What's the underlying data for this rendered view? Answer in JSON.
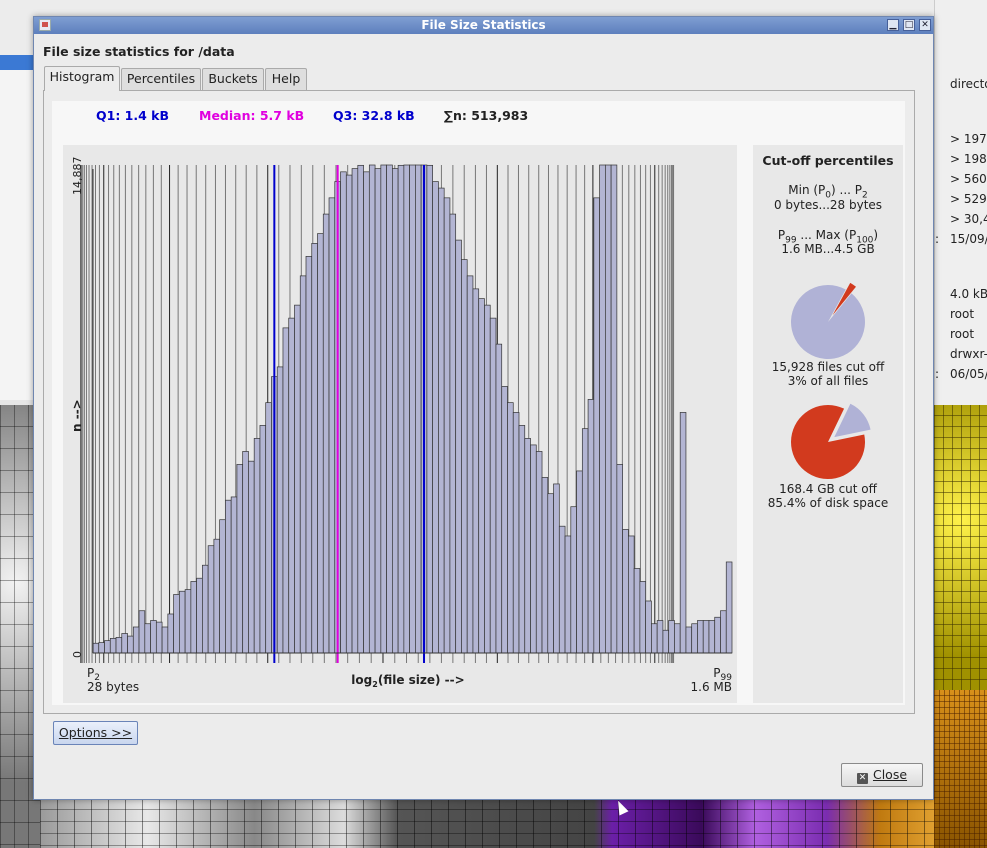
{
  "window": {
    "title": "File Size Statistics",
    "heading": "File size statistics for /data"
  },
  "tabs": [
    {
      "label": "Histogram",
      "active": true
    },
    {
      "label": "Percentiles",
      "active": false
    },
    {
      "label": "Buckets",
      "active": false
    },
    {
      "label": "Help",
      "active": false
    }
  ],
  "stats": {
    "q1": "Q1: 1.4 kB",
    "median": "Median: 5.7 kB",
    "q3": "Q3: 32.8 kB",
    "sum": "∑n: 513,983"
  },
  "colors": {
    "q1": "#0000cc",
    "median": "#e000e0",
    "q3": "#0000cc",
    "bar": "#b3b5d3",
    "pie_files": "#b0b2d6",
    "pie_disk": "#d23a1e"
  },
  "chart_data": {
    "type": "bar",
    "ylim": [
      0,
      14887
    ],
    "ytick_top": "14,887",
    "ytick_bottom": "0",
    "ylabel": "n -->",
    "xlabel_pre": "log",
    "xlabel_sub": "2",
    "xlabel_post": "(file size) -->",
    "left_label_p": "P",
    "left_label_sub": "2",
    "left_label_value": "28 bytes",
    "right_label_p": "P",
    "right_label_sub": "99",
    "right_label_value": "1.6 MB",
    "values": [
      300,
      320,
      380,
      450,
      480,
      600,
      520,
      800,
      1300,
      900,
      1000,
      950,
      800,
      1200,
      1800,
      1900,
      1950,
      2200,
      2300,
      2700,
      3300,
      3500,
      4100,
      4700,
      4800,
      5800,
      6200,
      5900,
      6600,
      7000,
      7700,
      8500,
      8800,
      10000,
      10300,
      10700,
      11600,
      12200,
      12600,
      12900,
      13500,
      14000,
      14500,
      14800,
      14700,
      14900,
      15000,
      14800,
      15300,
      14900,
      15400,
      15300,
      14900,
      15000,
      15300,
      15400,
      15600,
      15200,
      15000,
      14500,
      14300,
      14000,
      13500,
      12700,
      12100,
      11600,
      11200,
      10900,
      10700,
      10300,
      9500,
      8200,
      7700,
      7400,
      7000,
      6600,
      6400,
      6200,
      5400,
      4900,
      5200,
      3900,
      3600,
      4500,
      5600,
      6900,
      7800,
      14000,
      16200,
      20500,
      15100,
      5800,
      3800,
      3600,
      2600,
      2200,
      1600,
      900,
      1000,
      700,
      1000,
      900,
      7400,
      800,
      900,
      1000,
      1000,
      1000,
      1100,
      1300,
      2800
    ],
    "q1_index": 31.5,
    "median_index": 42.5,
    "q3_index": 57.5
  },
  "cutoff": {
    "title": "Cut-off percentiles",
    "min_label": "Min (P",
    "min_sub": "0",
    "min_mid": ") ... P",
    "min_sub2": "2",
    "min_value": "0 bytes...28 bytes",
    "max_p": "P",
    "max_sub": "99",
    "max_mid": " ... Max (P",
    "max_sub2": "100",
    "max_end": ")",
    "max_value": "1.6 MB...4.5 GB",
    "files_text": "15,928 files cut off",
    "files_pct": "3% of all files",
    "files_fraction": 0.03,
    "disk_text": "168.4 GB cut off",
    "disk_pct": "85.4% of disk space",
    "disk_fraction": 0.854
  },
  "buttons": {
    "options": "Options >>",
    "close": "Close"
  },
  "background": {
    "right_top": "directo",
    "rows": [
      "> 197",
      "> 198",
      "> 560",
      "> 529",
      "> 30,4"
    ],
    "date1": "15/09/",
    "size": "4.0 kB",
    "user": "root",
    "group": "root",
    "perm": "drwxr-",
    "date2": "06/05/",
    "colon": ":"
  }
}
